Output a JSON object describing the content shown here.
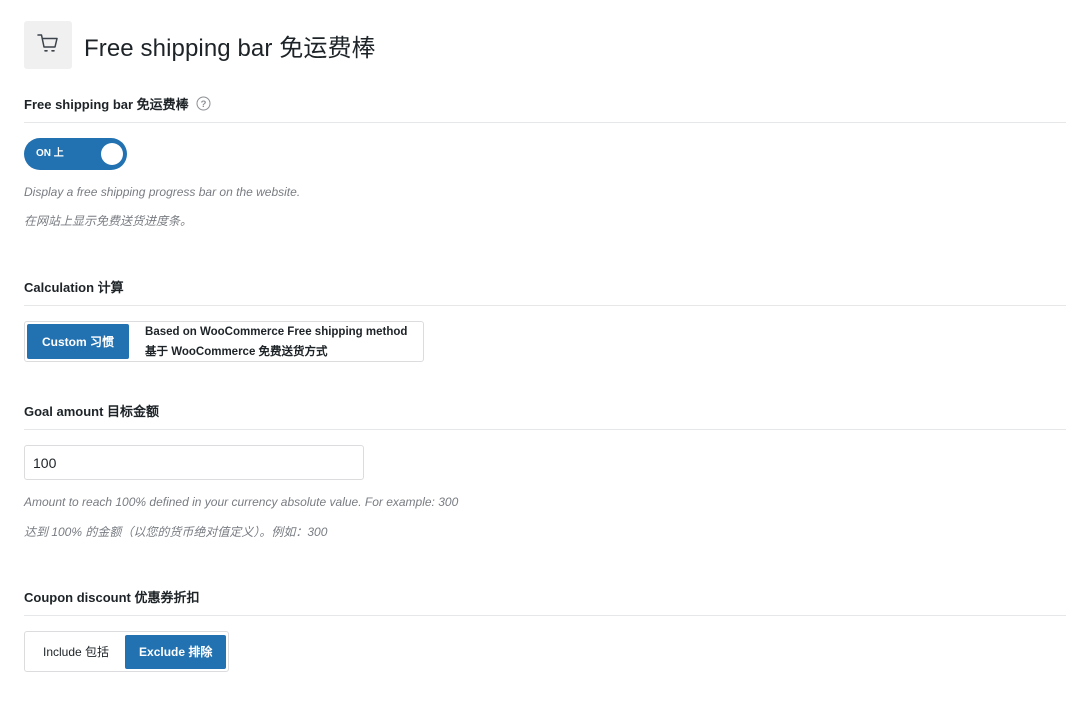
{
  "header": {
    "title": "Free shipping bar  免运费棒",
    "icon": "cart-icon"
  },
  "free_shipping": {
    "label": "Free shipping bar  免运费棒",
    "help_icon": "question-circle-icon",
    "toggle_label": "ON  上",
    "toggle_state": "on",
    "desc_en": "Display a free shipping progress bar on the website.",
    "desc_zh": "在网站上显示免费送货进度条。"
  },
  "calculation": {
    "label": "Calculation  计算",
    "options": [
      {
        "label": "Custom  习惯",
        "active": true
      },
      {
        "label_en": "Based on WooCommerce Free shipping method",
        "label_zh": "基于 WooCommerce 免费送货方式",
        "active": false
      }
    ]
  },
  "goal_amount": {
    "label": "Goal amount  目标金额",
    "value": "100",
    "desc_en": "Amount to reach 100% defined in your currency absolute value. For example: 300",
    "desc_zh": "达到 100% 的金额（以您的货币绝对值定义）。例如：300"
  },
  "coupon_discount": {
    "label": "Coupon discount  优惠券折扣",
    "options": [
      {
        "label": "Include  包括",
        "active": false
      },
      {
        "label": "Exclude  排除",
        "active": true
      }
    ]
  },
  "colors": {
    "accent": "#2271b1",
    "divider": "#e6e7e8",
    "muted_text": "#787c82"
  }
}
